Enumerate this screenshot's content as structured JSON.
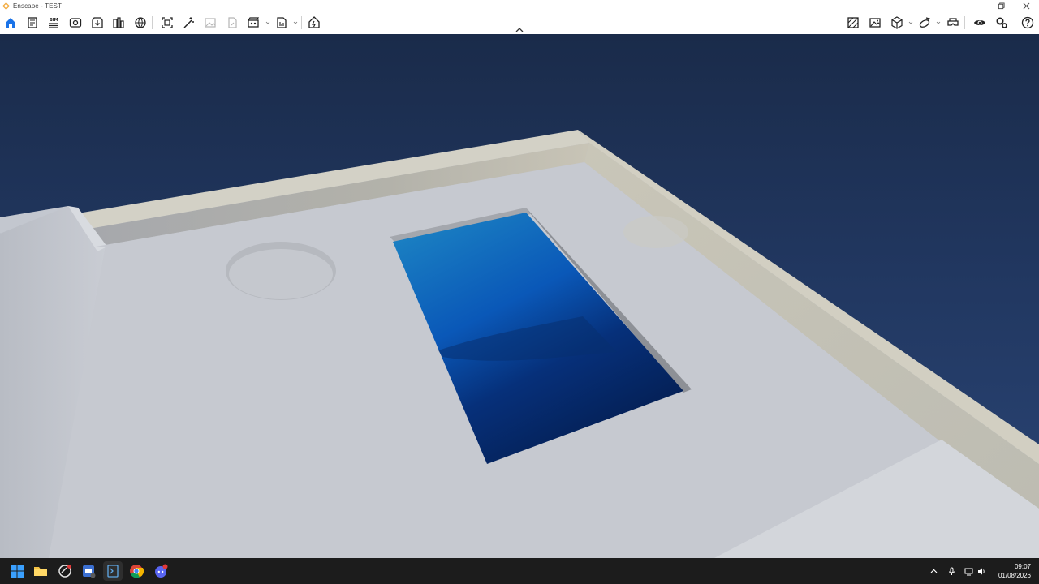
{
  "window": {
    "title": "Enscape - TEST"
  },
  "colors": {
    "accent": "#0078d4",
    "sky": "#213760",
    "pool_water": "#0a4ea8",
    "concrete": "#c9ccd2"
  },
  "toolbar": {
    "left_icons": [
      "home-icon",
      "document-icon",
      "bim-list-icon",
      "view-icon",
      "capture-icon",
      "asset-library-icon",
      "atmosphere-icon",
      "screenshot-icon",
      "magic-wand-icon",
      "image-icon",
      "export-file-icon",
      "video-editor-icon",
      "batch-render-icon",
      "upload-icon"
    ],
    "right_icons": [
      "materials-icon",
      "visual-settings-icon",
      "cube-view-icon",
      "orbit-icon",
      "vr-headset-icon",
      "eye-icon",
      "settings-icon",
      "help-icon"
    ]
  },
  "taskbar": {
    "apps": [
      "windows-start-icon",
      "file-explorer-icon",
      "sketchup-icon",
      "enscape-icon",
      "terminal-icon",
      "chrome-icon",
      "discord-icon"
    ],
    "tray": [
      "chevron-up-icon",
      "microphone-icon",
      "network-icon",
      "volume-icon"
    ],
    "time": "09:07",
    "date": "01/08/2026"
  }
}
